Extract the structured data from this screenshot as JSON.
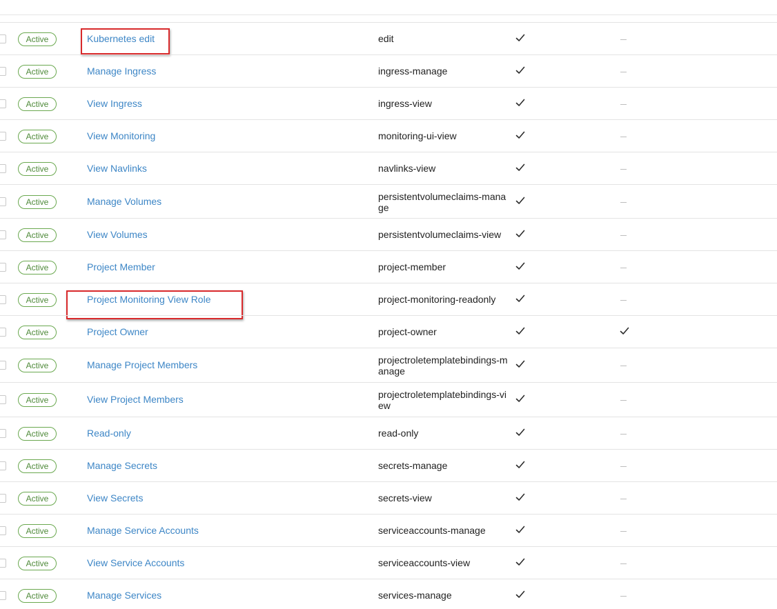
{
  "roles": [
    {
      "status": "Active",
      "name": "Kubernetes edit",
      "role_id": "edit",
      "col1_checked": true,
      "col2_checked": false
    },
    {
      "status": "Active",
      "name": "Manage Ingress",
      "role_id": "ingress-manage",
      "col1_checked": true,
      "col2_checked": false
    },
    {
      "status": "Active",
      "name": "View Ingress",
      "role_id": "ingress-view",
      "col1_checked": true,
      "col2_checked": false
    },
    {
      "status": "Active",
      "name": "View Monitoring",
      "role_id": "monitoring-ui-view",
      "col1_checked": true,
      "col2_checked": false
    },
    {
      "status": "Active",
      "name": "View Navlinks",
      "role_id": "navlinks-view",
      "col1_checked": true,
      "col2_checked": false
    },
    {
      "status": "Active",
      "name": "Manage Volumes",
      "role_id": "persistentvolumeclaims-manage",
      "col1_checked": true,
      "col2_checked": false
    },
    {
      "status": "Active",
      "name": "View Volumes",
      "role_id": "persistentvolumeclaims-view",
      "col1_checked": true,
      "col2_checked": false
    },
    {
      "status": "Active",
      "name": "Project Member",
      "role_id": "project-member",
      "col1_checked": true,
      "col2_checked": false
    },
    {
      "status": "Active",
      "name": "Project Monitoring View Role",
      "role_id": "project-monitoring-readonly",
      "col1_checked": true,
      "col2_checked": false
    },
    {
      "status": "Active",
      "name": "Project Owner",
      "role_id": "project-owner",
      "col1_checked": true,
      "col2_checked": true
    },
    {
      "status": "Active",
      "name": "Manage Project Members",
      "role_id": "projectroletemplatebindings-manage",
      "col1_checked": true,
      "col2_checked": false
    },
    {
      "status": "Active",
      "name": "View Project Members",
      "role_id": "projectroletemplatebindings-view",
      "col1_checked": true,
      "col2_checked": false
    },
    {
      "status": "Active",
      "name": "Read-only",
      "role_id": "read-only",
      "col1_checked": true,
      "col2_checked": false
    },
    {
      "status": "Active",
      "name": "Manage Secrets",
      "role_id": "secrets-manage",
      "col1_checked": true,
      "col2_checked": false
    },
    {
      "status": "Active",
      "name": "View Secrets",
      "role_id": "secrets-view",
      "col1_checked": true,
      "col2_checked": false
    },
    {
      "status": "Active",
      "name": "Manage Service Accounts",
      "role_id": "serviceaccounts-manage",
      "col1_checked": true,
      "col2_checked": false
    },
    {
      "status": "Active",
      "name": "View Service Accounts",
      "role_id": "serviceaccounts-view",
      "col1_checked": true,
      "col2_checked": false
    },
    {
      "status": "Active",
      "name": "Manage Services",
      "role_id": "services-manage",
      "col1_checked": true,
      "col2_checked": false
    }
  ],
  "icons": {
    "check": "check-icon",
    "dash": "dash-icon"
  },
  "colors": {
    "link": "#3d86c6",
    "badge_border": "#6aa84f",
    "badge_text": "#4f8a3a",
    "highlight": "#d9292b",
    "divider": "#e3e3e3"
  }
}
